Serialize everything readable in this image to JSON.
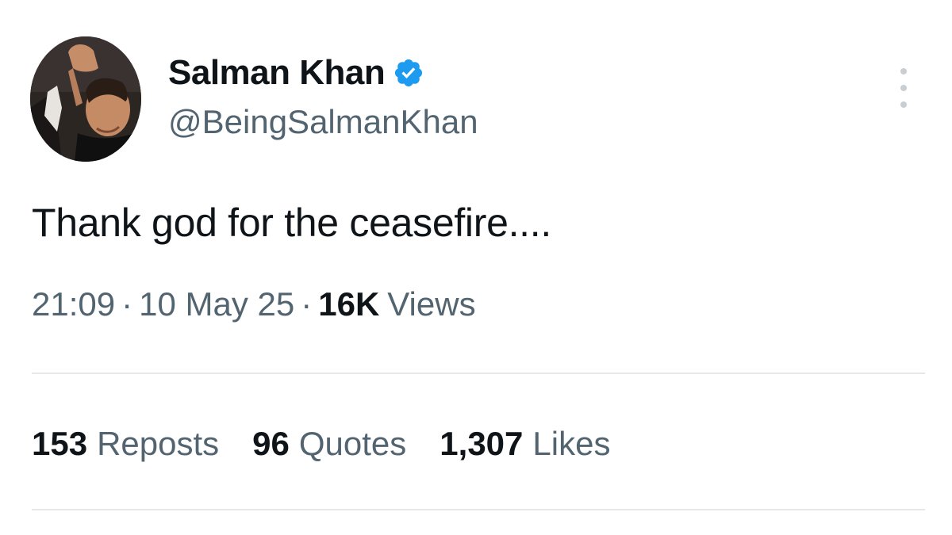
{
  "author": {
    "display_name": "Salman Khan",
    "handle": "@BeingSalmanKhan",
    "verified": true,
    "verified_icon": "verified-badge-icon",
    "verified_color": "#1d9bf0"
  },
  "tweet": {
    "text": "Thank god for the ceasefire....",
    "time": "21:09",
    "separator": "·",
    "date": "10 May 25",
    "views_count": "16K",
    "views_label": "Views"
  },
  "stats": [
    {
      "count": "153",
      "label": "Reposts"
    },
    {
      "count": "96",
      "label": "Quotes"
    },
    {
      "count": "1,307",
      "label": "Likes"
    }
  ],
  "menu": {
    "icon": "more-vertical-icon"
  },
  "colors": {
    "text_primary": "#0f1419",
    "text_secondary": "#536471",
    "divider": "#e4e8eb"
  }
}
